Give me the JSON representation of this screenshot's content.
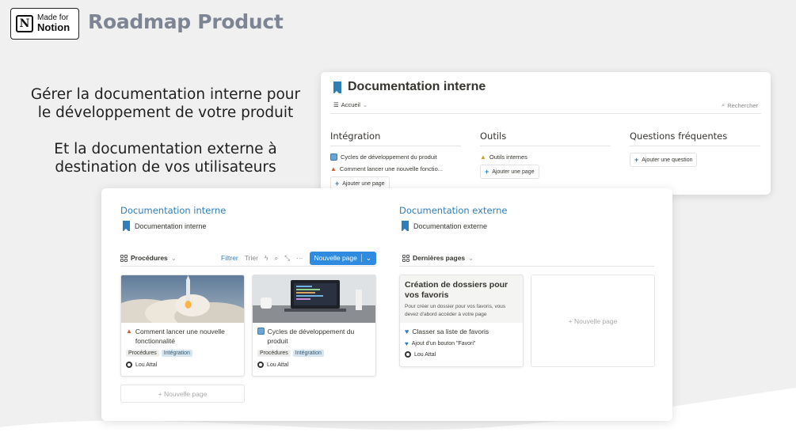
{
  "badge": {
    "line1": "Made for",
    "line2": "Notion",
    "logo_letter": "N"
  },
  "brand_title": "Roadmap Product",
  "taglines": {
    "first": "Gérer la documentation interne pour le développement de votre produit",
    "second": "Et la documentation externe à destination de vos utilisateurs"
  },
  "top_card": {
    "title": "Documentation interne",
    "nav_label": "Accueil",
    "search_label": "Rechercher",
    "columns": [
      {
        "heading": "Intégration",
        "items": [
          "Cycles de développement du produit",
          "Comment lancer une nouvelle fonctio..."
        ],
        "add_label": "Ajouter une page"
      },
      {
        "heading": "Outils",
        "items": [
          "Outils internes"
        ],
        "add_label": "Ajouter une page"
      },
      {
        "heading": "Questions fréquentes",
        "items": [],
        "add_label": "Ajouter une question"
      }
    ]
  },
  "main_card": {
    "internal": {
      "section_title": "Documentation interne",
      "sub_title": "Documentation interne",
      "view_label": "Procédures",
      "filter_label": "Filtrer",
      "sort_label": "Trier",
      "more_label": "···",
      "new_page_label": "Nouvelle page",
      "cards": [
        {
          "title": "Comment lancer une nouvelle fonctionnalité",
          "tags": [
            "Procédures",
            "Intégration"
          ],
          "author": "Lou Attal"
        },
        {
          "title": "Cycles de développement du produit",
          "tags": [
            "Procédures",
            "Intégration"
          ],
          "author": "Lou Attal"
        }
      ],
      "add_new_label": "+ Nouvelle page"
    },
    "external": {
      "section_title": "Documentation externe",
      "sub_title": "Documentation externe",
      "view_label": "Dernières pages",
      "card": {
        "heading": "Création de dossiers pour vos favoris",
        "description": "Pour créer un dossier pour vos favoris, vous devez d'abord accéder à votre page",
        "title": "Classer sa liste de favoris",
        "subitem": "Ajout d'un bouton \"Favori\"",
        "author": "Lou Attal"
      },
      "empty_label": "+ Nouvelle page"
    }
  },
  "colors": {
    "accent": "#2e7fb8",
    "button": "#2e8be0",
    "brand_title": "#7d8594",
    "background": "#f0f0f0"
  }
}
